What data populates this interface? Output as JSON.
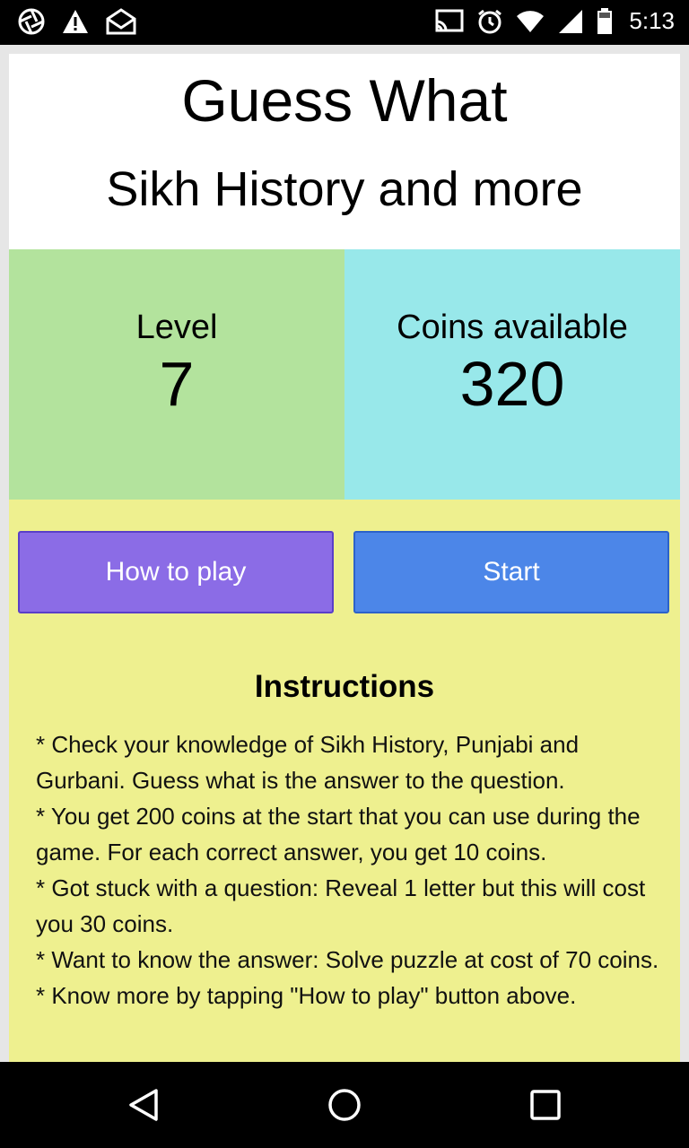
{
  "status_bar": {
    "time": "5:13",
    "icons": [
      "aperture-icon",
      "warning-icon",
      "mail-icon",
      "cast-icon",
      "alarm-icon",
      "wifi-icon",
      "signal-icon",
      "battery-icon"
    ]
  },
  "header": {
    "title": "Guess What",
    "subtitle": "Sikh History and more"
  },
  "stats": {
    "level_label": "Level",
    "level_value": "7",
    "coins_label": "Coins available",
    "coins_value": "320"
  },
  "buttons": {
    "how_to_play": "How to play",
    "start": "Start"
  },
  "instructions": {
    "title": "Instructions",
    "items": [
      "* Check your knowledge of Sikh History, Punjabi and Gurbani. Guess what is the answer to the question.",
      "* You get 200 coins at the start that you can use during the game. For each correct answer, you get 10 coins.",
      "* Got stuck with a question: Reveal 1 letter but this will cost you 30 coins.",
      "* Want to know the answer: Solve puzzle at cost of 70 coins.",
      "* Know more by tapping \"How to play\" button above."
    ]
  },
  "nav_bar": {
    "icons": [
      "back-icon",
      "home-icon",
      "recents-icon"
    ]
  },
  "colors": {
    "level_bg": "#b3e39d",
    "coins_bg": "#98e8ea",
    "content_bg": "#eef08f",
    "how_to_play_bg": "#8b6ce6",
    "start_bg": "#4c86e8"
  }
}
